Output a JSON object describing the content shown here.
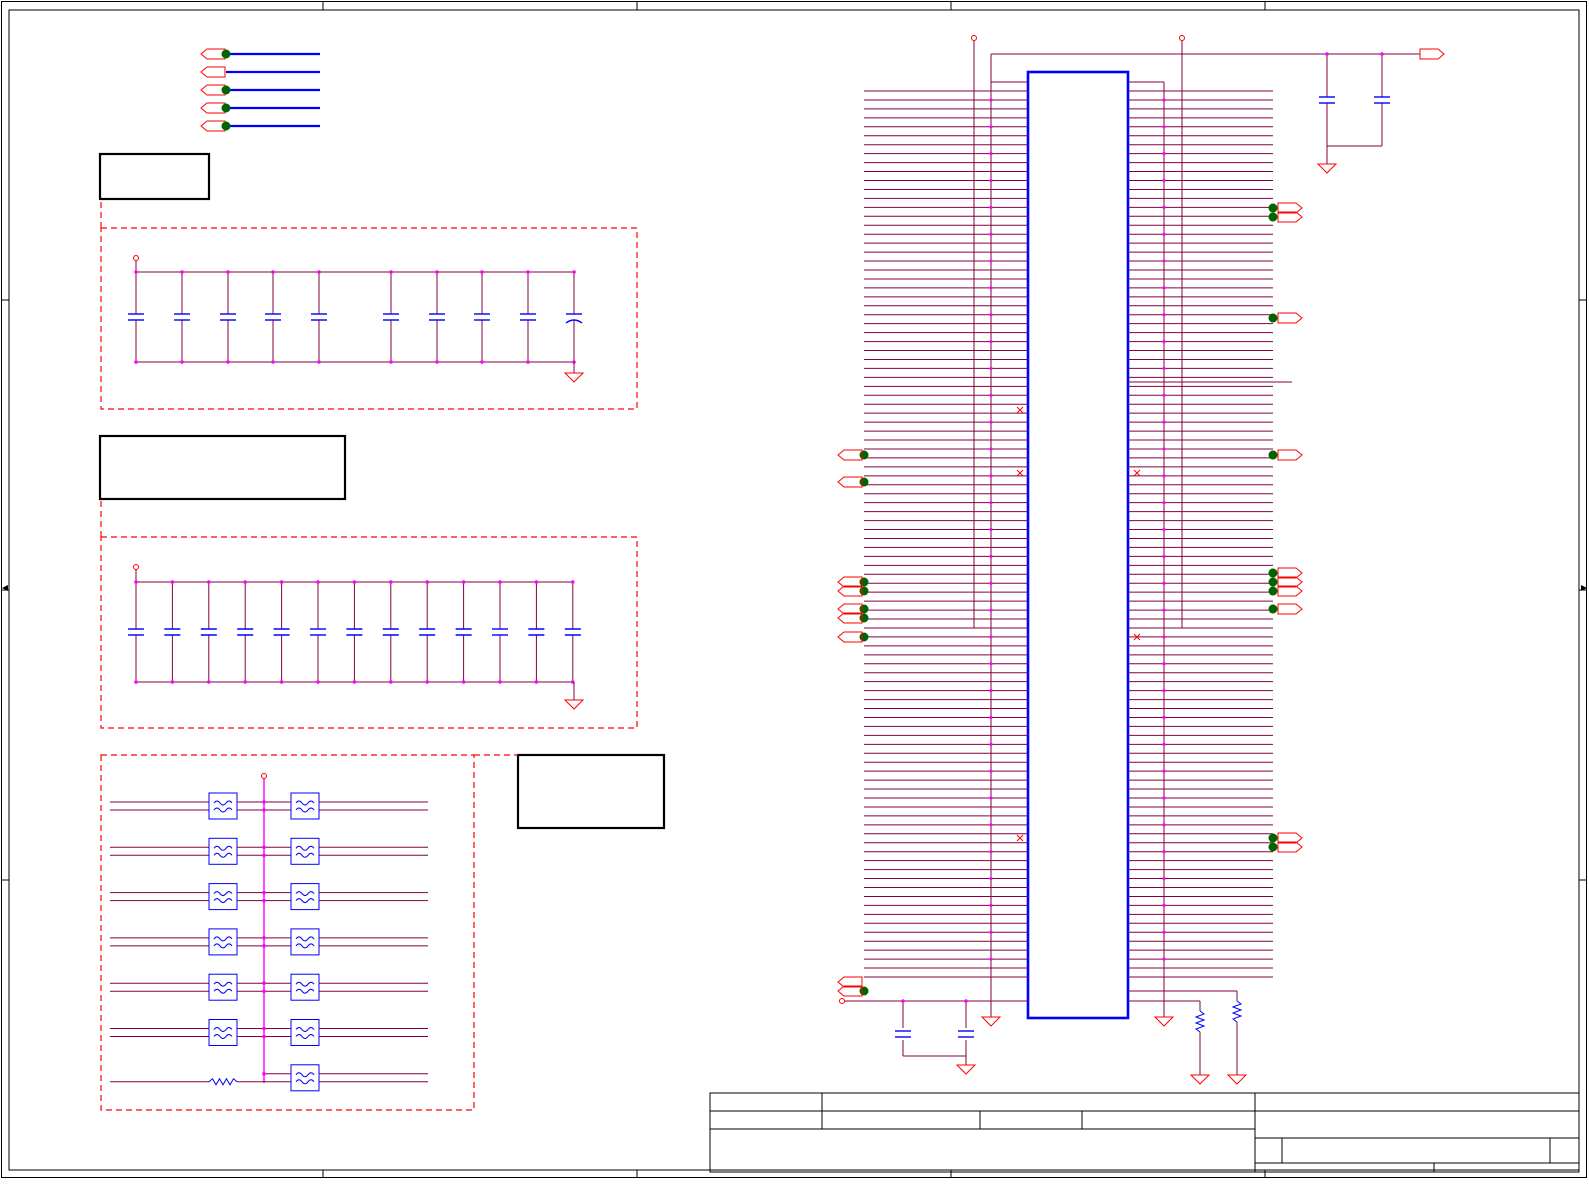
{
  "sheet": {
    "columns": 5,
    "rows": 4
  },
  "colors": {
    "net": "#800040",
    "bus": "#0000ff",
    "component": "#0000ff",
    "dashed_group": "#ff0000",
    "port": "#ff0000",
    "junction": "#ff00ff",
    "off_page_dot": "#006400",
    "frame": "#000000"
  },
  "symbols": {
    "ground": "ground-icon",
    "capacitor": "capacitor-icon",
    "resistor": "resistor-icon",
    "ferrite_bead": "ferrite-bead-icon",
    "port": "port-icon",
    "no_connect": "no-connect-icon",
    "power": "power-pin-icon"
  },
  "groups": {
    "decoupling_1": {
      "capacitor_count": 10,
      "polarized_count": 1
    },
    "decoupling_2": {
      "capacitor_count": 13
    },
    "filter_network": {
      "bead_rows": 7,
      "resistor_count": 1
    }
  },
  "connector": {
    "left_pin_rows": 100,
    "right_pin_rows": 100
  },
  "title_block": {
    "title": "",
    "size": "",
    "document_number": "",
    "rev": "",
    "date": "",
    "sheet": ""
  }
}
